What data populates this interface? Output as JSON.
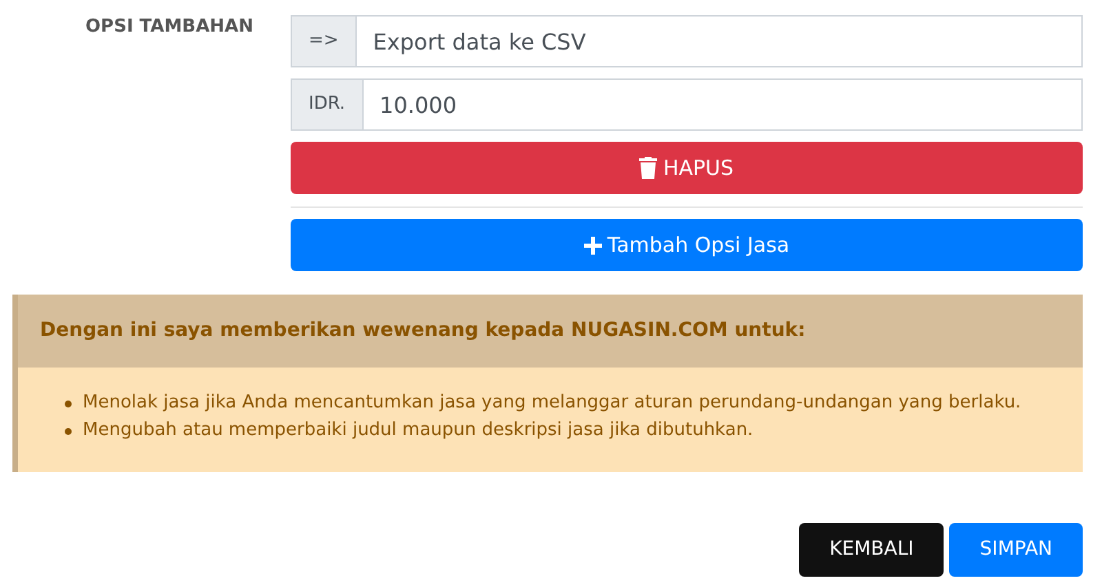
{
  "section_label": "OPSI TAMBAHAN",
  "fields": [
    {
      "prefix": "=>",
      "value": "Export data ke CSV"
    },
    {
      "prefix": "IDR.",
      "value": "10.000"
    }
  ],
  "delete_button": "HAPUS",
  "add_button": "Tambah Opsi Jasa",
  "notice": {
    "heading": "Dengan ini saya memberikan wewenang kepada NUGASIN.COM untuk:",
    "items": [
      "Menolak jasa jika Anda mencantumkan jasa yang melanggar aturan perundang-undangan yang berlaku.",
      "Mengubah atau memperbaiki judul maupun deskripsi jasa jika dibutuhkan."
    ]
  },
  "buttons": [
    {
      "label": "KEMBALI",
      "kind": "dark"
    },
    {
      "label": "SIMPAN",
      "kind": "primary"
    }
  ]
}
